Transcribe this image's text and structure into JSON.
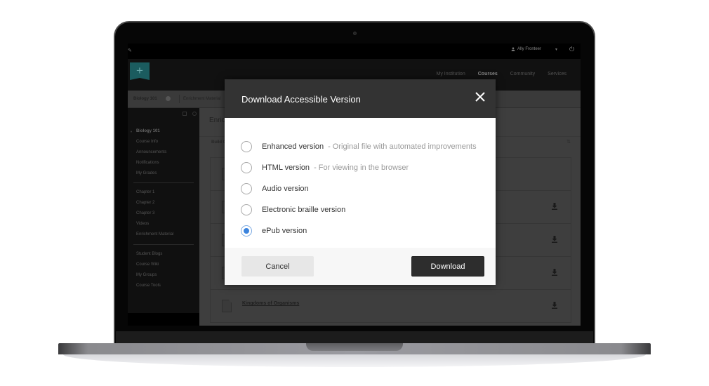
{
  "topbar": {
    "user_name": "Ally Fronteer"
  },
  "header": {
    "nav": [
      {
        "label": "My Institution",
        "active": false
      },
      {
        "label": "Courses",
        "active": true
      },
      {
        "label": "Community",
        "active": false
      },
      {
        "label": "Services",
        "active": false
      }
    ]
  },
  "breadcrumb": {
    "course": "Biology 101",
    "page": "Enrichment Material"
  },
  "sidebar": {
    "course_title": "Biology 101",
    "group1": [
      "Course Info",
      "Announcements",
      "Notifications",
      "My Grades"
    ],
    "group2": [
      "Chapter 1",
      "Chapter 2",
      "Chapter 3",
      "Videos",
      "Enrichment Material"
    ],
    "group3": [
      "Student Blogs",
      "Course Wiki",
      "My Groups",
      "Course Tools"
    ]
  },
  "main": {
    "title": "Enrichment Material",
    "build_label": "Build Content",
    "items": [
      {
        "title": "",
        "has_download": false
      },
      {
        "title": "",
        "has_download": true
      },
      {
        "title": "",
        "has_download": true
      },
      {
        "title": "",
        "has_download": true
      },
      {
        "title": "Kingdoms of Organisms",
        "has_download": true
      }
    ]
  },
  "modal": {
    "title": "Download Accessible Version",
    "options": [
      {
        "label": "Enhanced version",
        "description": "- Original file with automated improvements",
        "checked": false
      },
      {
        "label": "HTML version",
        "description": "- For viewing in the browser",
        "checked": false
      },
      {
        "label": "Audio version",
        "description": "",
        "checked": false
      },
      {
        "label": "Electronic braille version",
        "description": "",
        "checked": false
      },
      {
        "label": "ePub version",
        "description": "",
        "checked": true
      }
    ],
    "cancel_label": "Cancel",
    "download_label": "Download"
  },
  "colors": {
    "modal_header": "#333333",
    "radio_selected": "#3a83dd",
    "download_button": "#2d2d2d",
    "logo_teal": "#1b5c5f"
  }
}
